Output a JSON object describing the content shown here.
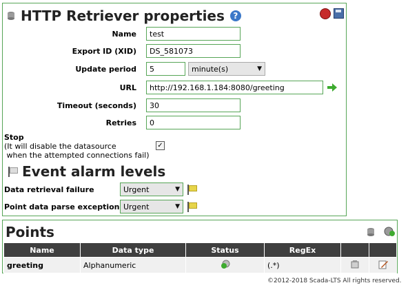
{
  "properties": {
    "title": "HTTP Retriever properties",
    "fields": {
      "name": {
        "label": "Name",
        "value": "test"
      },
      "xid": {
        "label": "Export ID (XID)",
        "value": "DS_581073"
      },
      "update_period": {
        "label": "Update period",
        "value": "5",
        "unit": "minute(s)"
      },
      "url": {
        "label": "URL",
        "value": "http://192.168.1.184:8080/greeting"
      },
      "timeout": {
        "label": "Timeout (seconds)",
        "value": "30"
      },
      "retries": {
        "label": "Retries",
        "value": "0"
      }
    },
    "stop": {
      "label": "Stop",
      "note_line1": "(It will disable the datasource",
      "note_line2": " when the attempted connections fail)",
      "checked": true
    }
  },
  "events": {
    "title": "Event alarm levels",
    "items": [
      {
        "label": "Data retrieval failure",
        "level": "Urgent"
      },
      {
        "label": "Point data parse exception",
        "level": "Urgent"
      }
    ]
  },
  "points": {
    "title": "Points",
    "columns": [
      "Name",
      "Data type",
      "Status",
      "RegEx",
      "",
      ""
    ],
    "rows": [
      {
        "name": "greeting",
        "data_type": "Alphanumeric",
        "regex": "(.*)"
      }
    ]
  },
  "footer": {
    "copyright": "©2012-2018 Scada-LTS All rights reserved."
  },
  "icons": {
    "datasource": "database-icon",
    "help": "help-icon",
    "delete": "delete-icon",
    "save": "save-icon",
    "go": "arrow-right-icon",
    "flag": "flag-icon",
    "add_point": "add-point-icon",
    "status": "status-icon",
    "edit": "edit-icon"
  },
  "colors": {
    "border": "#56a556",
    "header_bg": "#3f3f3f",
    "help": "#3b78c8",
    "delete": "#c62a2a",
    "go": "#3eab2f"
  }
}
